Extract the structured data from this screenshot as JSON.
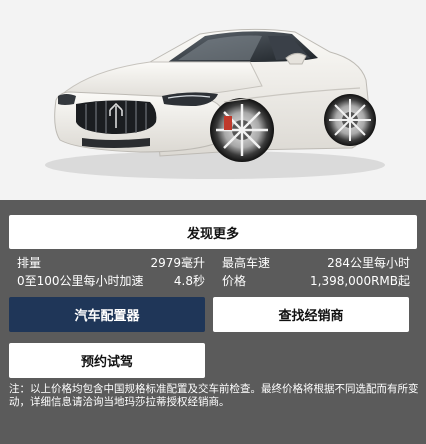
{
  "actions": {
    "discover_more": "发现更多",
    "configurator": "汽车配置器",
    "find_dealer": "查找经销商",
    "book_test_drive": "预约试驾"
  },
  "specs": {
    "displacement_label": "排量",
    "displacement_value": "2979毫升",
    "top_speed_label": "最高车速",
    "top_speed_value": "284公里每小时",
    "acceleration_label": "0至100公里每小时加速",
    "acceleration_value": "4.8秒",
    "price_label": "价格",
    "price_value": "1,398,000RMB起"
  },
  "disclaimer": "注：以上价格均包含中国规格标准配置及交车前检查。最终价格将根据不同选配而有所变动，详细信息请洽询当地玛莎拉蒂授权经销商。",
  "colors": {
    "panel_bg": "#5b5b5b",
    "primary_button": "#1f3658",
    "secondary_button": "#ffffff"
  }
}
